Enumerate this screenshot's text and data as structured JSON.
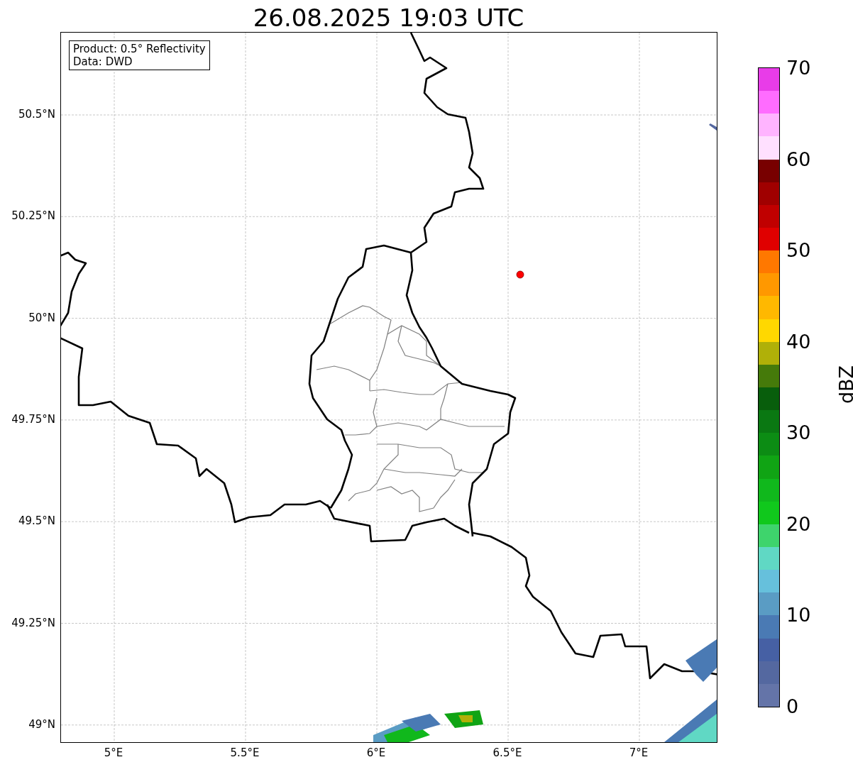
{
  "title": "26.08.2025 19:03 UTC",
  "legend": [
    "Product: 0.5° Reflectivity",
    "Data: DWD"
  ],
  "map": {
    "xticks": [
      "5°E",
      "5.5°E",
      "6°E",
      "6.5°E",
      "7°E"
    ],
    "yticks": [
      "50.5°N",
      "50.25°N",
      "50°N",
      "49.75°N",
      "49.5°N",
      "49.25°N",
      "49°N"
    ]
  },
  "colorbar": {
    "label": "dBZ",
    "ticks": [
      "70",
      "60",
      "50",
      "40",
      "30",
      "20",
      "10",
      "0"
    ],
    "bins": [
      {
        "color": "#e83ce8"
      },
      {
        "color": "#ff6cff"
      },
      {
        "color": "#ffb4ff"
      },
      {
        "color": "#ffe0ff"
      },
      {
        "color": "#780000"
      },
      {
        "color": "#a00000"
      },
      {
        "color": "#c00000"
      },
      {
        "color": "#e00000"
      },
      {
        "color": "#ff7800"
      },
      {
        "color": "#ff9800"
      },
      {
        "color": "#ffb800"
      },
      {
        "color": "#ffd800"
      },
      {
        "color": "#b0b008"
      },
      {
        "color": "#457a0a"
      },
      {
        "color": "#085e0c"
      },
      {
        "color": "#0a7812"
      },
      {
        "color": "#0c8c14"
      },
      {
        "color": "#10a414"
      },
      {
        "color": "#10b81c"
      },
      {
        "color": "#10c81c"
      },
      {
        "color": "#3ed46c"
      },
      {
        "color": "#60d8c4"
      },
      {
        "color": "#66c0dc"
      },
      {
        "color": "#5a9cc4"
      },
      {
        "color": "#4a7ab4"
      },
      {
        "color": "#4660a4"
      },
      {
        "color": "#5468a0"
      },
      {
        "color": "#6474a8"
      }
    ]
  }
}
